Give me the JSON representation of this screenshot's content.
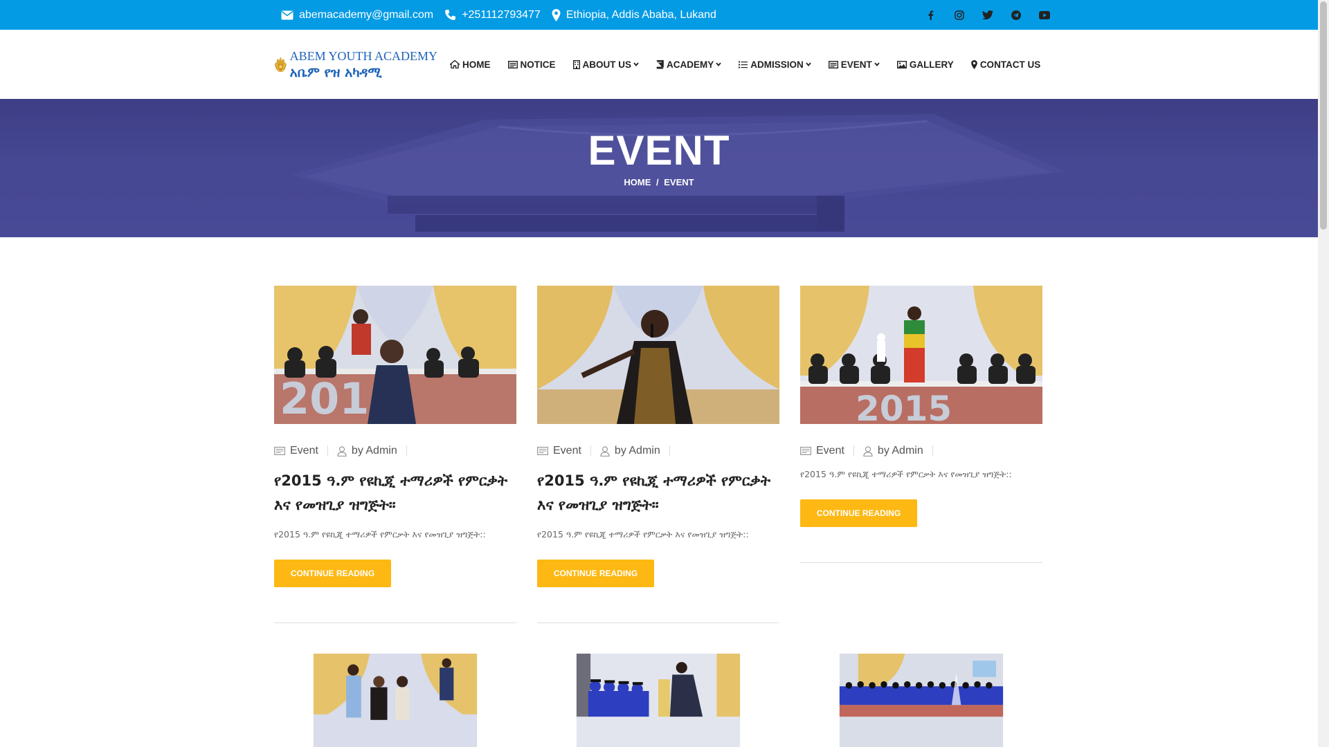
{
  "topbar": {
    "email": "abemacademy@gmail.com",
    "phone": "+251112793477",
    "location": "Ethiopia, Addis Ababa, Lukand",
    "social_icons": [
      "facebook-icon",
      "instagram-icon",
      "twitter-icon",
      "telegram-icon",
      "youtube-icon"
    ]
  },
  "logo": {
    "name_en": "ABEM YOUTH ACADEMY",
    "name_am": "አቤም የዝ አካዳሚ"
  },
  "nav": {
    "items": [
      {
        "label": "HOME",
        "icon": "home-icon",
        "dropdown": false
      },
      {
        "label": "NOTICE",
        "icon": "notice-icon",
        "dropdown": false
      },
      {
        "label": "ABOUT US",
        "icon": "building-icon",
        "dropdown": true
      },
      {
        "label": "ACADEMY",
        "icon": "book-icon",
        "dropdown": true
      },
      {
        "label": "ADMISSION",
        "icon": "list-icon",
        "dropdown": true
      },
      {
        "label": "EVENT",
        "icon": "event-icon",
        "dropdown": true
      },
      {
        "label": "GALLERY",
        "icon": "image-icon",
        "dropdown": false
      },
      {
        "label": "CONTACT US",
        "icon": "map-marker-icon",
        "dropdown": false
      }
    ]
  },
  "banner": {
    "title": "EVENT",
    "breadcrumb": {
      "home": "HOME",
      "separator": "/",
      "current": "EVENT"
    }
  },
  "posts": [
    {
      "category": "Event",
      "author": "by Admin",
      "title": "የ2015 ዓ.ም የዩኪጂ ተማሪዎች የምርቃት እና የመዝጊያ ዝግጅት።",
      "excerpt": "የ2015 ዓ.ም የዩኪጂ ተማሪዎች የምርቃት እና የመዝጊያ ዝግጅት::",
      "button": "CONTINUE READING"
    },
    {
      "category": "Event",
      "author": "by Admin",
      "title": "የ2015 ዓ.ም የዩኪጂ ተማሪዎች የምርቃት እና የመዝጊያ ዝግጅት።",
      "excerpt": "የ2015 ዓ.ም የዩኪጂ ተማሪዎች የምርቃት እና የመዝጊያ ዝግጅት::",
      "button": "CONTINUE READING"
    },
    {
      "category": "Event",
      "author": "by Admin",
      "title": "",
      "excerpt": "የ2015 ዓ.ም የዩኪጂ ተማሪዎች የምርቃት እና የመዝጊያ ዝግጅት::",
      "button": "CONTINUE READING"
    }
  ],
  "colors": {
    "topbar": "#049be5",
    "accent_button": "#fdb813",
    "banner": "#4a4c98",
    "logo_text": "#1e63b8"
  }
}
